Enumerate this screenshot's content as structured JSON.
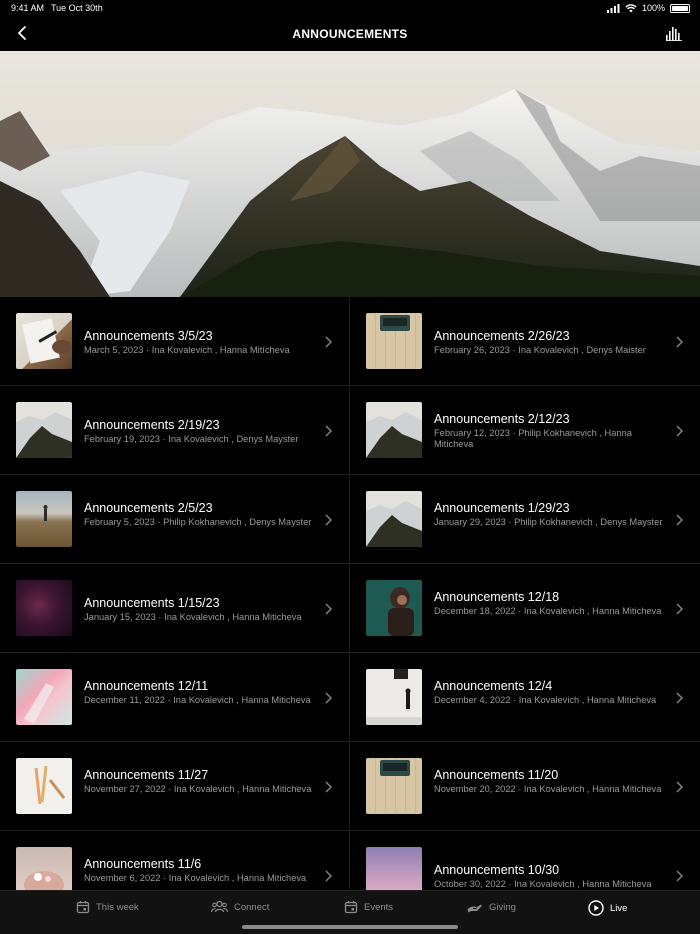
{
  "status": {
    "time": "9:41 AM",
    "date": "Tue Oct 30th",
    "battery": "100%"
  },
  "nav": {
    "title": "ANNOUNCEMENTS",
    "back_icon": "chevron-left-icon",
    "audio_icon": "audio-bars-icon"
  },
  "hero": {
    "icon": "mountain-photo"
  },
  "items": [
    {
      "title": "Announcements 3/5/23",
      "meta": "March 5, 2023 · Ina Kovalevich , Hanna Mitícheva",
      "thumb": "notebook-photo"
    },
    {
      "title": "Announcements 2/26/23",
      "meta": "February 26, 2023 · Ina Kovalevich , Denys Maister",
      "thumb": "typewriter-photo"
    },
    {
      "title": "Announcements 2/19/23",
      "meta": "February 19, 2023 · Ina Kovalevich , Denys Mayster",
      "thumb": "mountain-photo"
    },
    {
      "title": "Announcements 2/12/23",
      "meta": "February 12, 2023 · Philip Kokhanevich , Hanna Miticheva",
      "thumb": "mountain-photo"
    },
    {
      "title": "Announcements 2/5/23",
      "meta": "February 5, 2023 · Philip Kokhanevich , Denys Mayster",
      "thumb": "field-photo"
    },
    {
      "title": "Announcements 1/29/23",
      "meta": "January 29, 2023 · Philip Kokhanevich , Denys Mayster",
      "thumb": "mountain-photo"
    },
    {
      "title": "Announcements 1/15/23",
      "meta": "January 15, 2023 · Ina Kovalevich , Hanna Miticheva",
      "thumb": "nebula-photo"
    },
    {
      "title": "Announcements 12/18",
      "meta": "December 18, 2022 · Ina Kovalevich , Hanna Miticheva",
      "thumb": "portrait-photo"
    },
    {
      "title": "Announcements 12/11",
      "meta": "December 11, 2022 · Ina Kovalevich , Hanna Miticheva",
      "thumb": "paint-photo"
    },
    {
      "title": "Announcements 12/4",
      "meta": "December 4, 2022 · Ina Kovalevich , Hanna Miticheva",
      "thumb": "wall-figure-photo"
    },
    {
      "title": "Announcements 11/27",
      "meta": "November 27, 2022 · Ina Kovalevich , Hanna Miticheva",
      "thumb": "pencils-photo"
    },
    {
      "title": "Announcements 11/20",
      "meta": "November 20, 2022 · Ina Kovalevich , Hanna Miticheva",
      "thumb": "typewriter-photo"
    },
    {
      "title": "Announcements 11/6",
      "meta": "November 6, 2022 · Ina Kovalevich , Hanna Miticheva",
      "thumb": "flowers-photo"
    },
    {
      "title": "Announcements 10/30",
      "meta": "October 30, 2022 · Ina Kovalevich , Hanna Miticheva",
      "thumb": "sky-photo"
    }
  ],
  "tabs": [
    {
      "label": "This week",
      "icon": "calendar-icon",
      "active": false
    },
    {
      "label": "Connect",
      "icon": "people-icon",
      "active": false
    },
    {
      "label": "Events",
      "icon": "calendar-icon",
      "active": false
    },
    {
      "label": "Giving",
      "icon": "giving-hand-icon",
      "active": false
    },
    {
      "label": "Live",
      "icon": "play-circle-icon",
      "active": true
    }
  ],
  "colors": {
    "background": "#000000",
    "divider": "#1e1e1e",
    "meta_text": "#9a9a9a",
    "tab_bar": "#121212",
    "tab_inactive": "#8c8c8c"
  }
}
